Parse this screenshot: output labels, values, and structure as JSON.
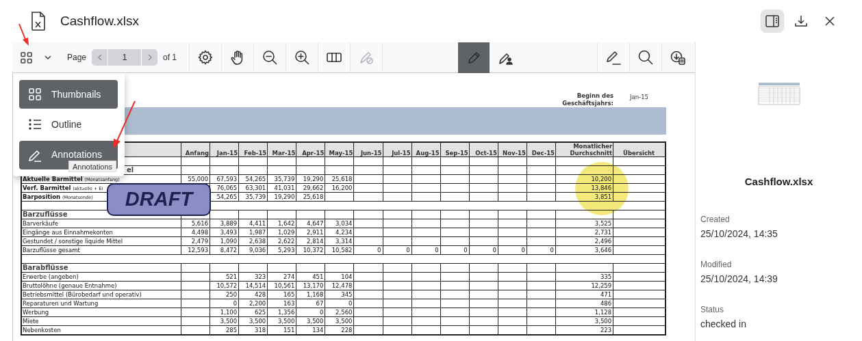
{
  "header": {
    "title": "Cashflow.xlsx",
    "panel_toggle_on": true
  },
  "toolbar": {
    "page_label": "Page",
    "page_value": "1",
    "page_total": "of 1",
    "tools_left": [
      {
        "kind": "settings",
        "disabled": false
      },
      {
        "kind": "hand",
        "disabled": false
      },
      {
        "kind": "zoom-out",
        "disabled": false
      },
      {
        "kind": "zoom-in",
        "disabled": false
      },
      {
        "kind": "columns",
        "disabled": false
      },
      {
        "kind": "pen-slash",
        "disabled": true
      }
    ],
    "tools_center": [
      {
        "kind": "pencil",
        "selected": true
      },
      {
        "kind": "pencil-people",
        "selected": false
      }
    ],
    "tools_right": [
      {
        "kind": "pen-line"
      },
      {
        "kind": "search"
      },
      {
        "kind": "download-doc"
      }
    ]
  },
  "menu": {
    "items": [
      {
        "kind": "thumbnails",
        "label": "Thumbnails",
        "selected": true
      },
      {
        "kind": "outline",
        "label": "Outline",
        "selected": false
      },
      {
        "kind": "annotations",
        "label": "Annotations",
        "selected": true
      }
    ],
    "tooltip": "Annotations"
  },
  "document": {
    "fiscal_label": "Beginn des Geschäftsjahrs:",
    "fiscal_value": "Jan-15",
    "stamp": "DRAFT",
    "columns": [
      "Anfang",
      "Jan-15",
      "Feb-15",
      "Mar-15",
      "Apr-15",
      "May-15",
      "Jun-15",
      "Jul-15",
      "Aug-15",
      "Sep-15",
      "Oct-15",
      "Nov-15",
      "Dec-15",
      "Monatlicher Durchschnitt",
      "Übersicht"
    ],
    "rows": [
      {
        "kind": "blank"
      },
      {
        "kind": "partial-section",
        "label": "el"
      },
      {
        "kind": "key",
        "label": "Aktuelle Barmittel",
        "note": "(Monatsanfang)",
        "start": "55,000",
        "months": [
          "67,593",
          "54,265",
          "35,739",
          "19,290",
          "25,618"
        ],
        "average": "10,200"
      },
      {
        "kind": "key",
        "label": "Verf. Barmittel",
        "note": "(aktuelle + Ei",
        "months": [
          "76,065",
          "63,301",
          "41,031",
          "29,662",
          "16,200"
        ],
        "average": "13,846"
      },
      {
        "kind": "key",
        "label": "Barposition",
        "note": "(Monatsende)",
        "months": [
          "54,265",
          "35,739",
          "19,290",
          "25,618"
        ],
        "average": "3,851"
      },
      {
        "kind": "spacer"
      },
      {
        "kind": "section",
        "label": "Barzuflüsse"
      },
      {
        "kind": "item",
        "label": "Barverkäufe",
        "start": "5,616",
        "months": [
          "3,889",
          "4,411",
          "1,642",
          "4,647",
          "3,034"
        ],
        "average": "3,525"
      },
      {
        "kind": "item",
        "label": "Eingänge aus Einnahmekonten",
        "start": "4,498",
        "months": [
          "3,493",
          "1,987",
          "1,029",
          "2,911",
          "4,234"
        ],
        "average": "2,731"
      },
      {
        "kind": "item",
        "label": "Gestundet / sonstige liquide Mittel",
        "start": "2,479",
        "months": [
          "1,090",
          "2,638",
          "2,622",
          "2,814",
          "3,314"
        ],
        "average": "2,496"
      },
      {
        "kind": "item",
        "label": "Barzuflüsse gesamt",
        "start": "12,593",
        "months": [
          "8,472",
          "9,036",
          "5,293",
          "10,372",
          "10,582",
          "0",
          "0",
          "0",
          "0",
          "0",
          "0",
          "0"
        ],
        "average": "3,646"
      },
      {
        "kind": "spacer"
      },
      {
        "kind": "section",
        "label": "Barabflüsse"
      },
      {
        "kind": "item",
        "label": "Erwerbe (angeben)",
        "months": [
          "521",
          "323",
          "274",
          "451",
          "104"
        ],
        "average": "335"
      },
      {
        "kind": "item",
        "label": "Bruttolöhne (genaue Entnahme)",
        "months": [
          "10,572",
          "14,514",
          "10,561",
          "13,170",
          "12,478"
        ],
        "average": "12,259"
      },
      {
        "kind": "item",
        "label": "Betriebsmittel (Bürobedarf und operativ)",
        "months": [
          "250",
          "428",
          "165",
          "1,168",
          "345"
        ],
        "average": "471"
      },
      {
        "kind": "item",
        "label": "Reparaturen und Wartung",
        "months": [
          "0",
          "2,200",
          "163",
          "67",
          "0"
        ],
        "average": "486"
      },
      {
        "kind": "item",
        "label": "Werbung",
        "months": [
          "1,100",
          "625",
          "1,356",
          "0",
          "2,560"
        ],
        "average": "1,128"
      },
      {
        "kind": "item",
        "label": "Miete",
        "months": [
          "3,500",
          "3,500",
          "3,500",
          "3,500",
          "3,500"
        ],
        "average": "3,500"
      },
      {
        "kind": "item",
        "label": "Nebenkosten",
        "months": [
          "285",
          "318",
          "151",
          "134",
          "228"
        ],
        "average": "223"
      }
    ]
  },
  "details": {
    "file_name": "Cashflow.xlsx",
    "fields": [
      {
        "label": "Created",
        "value": "25/10/2024, 14:35"
      },
      {
        "label": "Modified",
        "value": "25/10/2024, 14:39"
      },
      {
        "label": "Status",
        "value": "checked in"
      }
    ]
  }
}
